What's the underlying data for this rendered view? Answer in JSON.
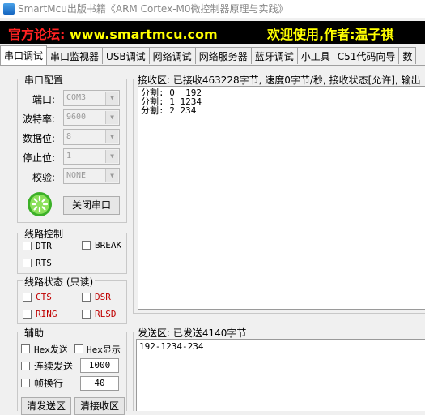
{
  "window": {
    "title": "SmartMcu出版书籍《ARM Cortex-M0微控制器原理与实践》"
  },
  "banner": {
    "left_prefix": "官方论坛:",
    "left_url": "www.smartmcu.com",
    "right": "欢迎使用,作者:温子祺"
  },
  "colors": {
    "banner_red": "#ff2222",
    "banner_yellow": "#ffff00",
    "banner_bg": "#000000",
    "signal_red": "#c00000"
  },
  "tabs": [
    "串口调试",
    "串口监视器",
    "USB调试",
    "网络调试",
    "网络服务器",
    "蓝牙调试",
    "小工具",
    "C51代码向导",
    "数"
  ],
  "serial_config": {
    "title": "串口配置",
    "port_label": "端口:",
    "port_value": "COM3",
    "baud_label": "波特率:",
    "baud_value": "9600",
    "data_label": "数据位:",
    "data_value": "8",
    "stop_label": "停止位:",
    "stop_value": "1",
    "parity_label": "校验:",
    "parity_value": "NONE",
    "close_button": "关闭串口",
    "status_icon": "green-led-icon"
  },
  "line_control": {
    "title": "线路控制",
    "dtr": "DTR",
    "break": "BREAK",
    "rts": "RTS"
  },
  "line_status": {
    "title": "线路状态 (只读)",
    "cts": "CTS",
    "dsr": "DSR",
    "ring": "RING",
    "rlsd": "RLSD"
  },
  "aux": {
    "title": "辅助",
    "hex_send": "Hex发送",
    "hex_display": "Hex显示",
    "continuous_send": "连续发送",
    "continuous_value": "1000",
    "frame_newline": "帧换行",
    "frame_value": "40",
    "clear_send": "清发送区",
    "clear_recv": "清接收区"
  },
  "receive": {
    "title": "接收区: 已接收463228字节, 速度0字节/秒, 接收状态[允许], 输出",
    "lines": [
      "分割: 0  192",
      "分割: 1 1234",
      "分割: 2 234"
    ]
  },
  "send": {
    "title": "发送区: 已发送4140字节",
    "content": "192-1234-234"
  }
}
